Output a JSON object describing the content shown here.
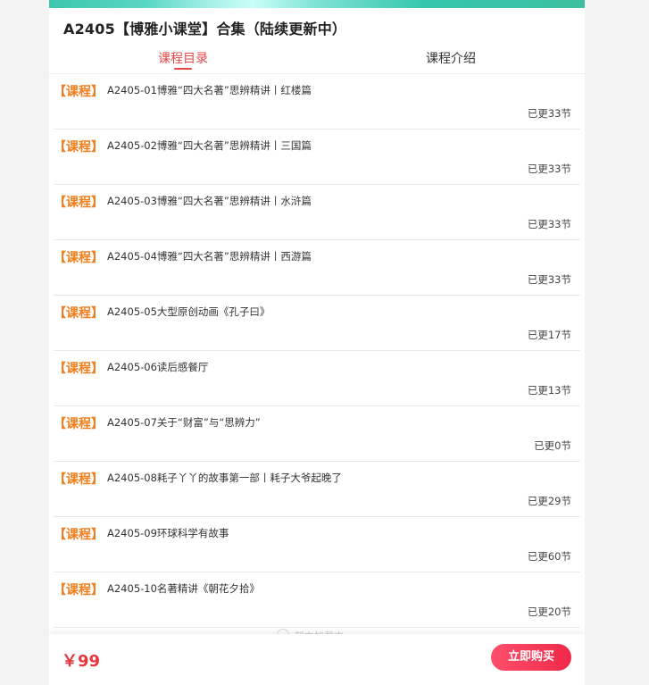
{
  "header": {
    "title": "A2405【博雅小课堂】合集（陆续更新中）"
  },
  "tabs": [
    {
      "label": "课程目录",
      "active": true
    },
    {
      "label": "课程介绍",
      "active": false
    }
  ],
  "course_list": {
    "items": [
      {
        "tag": "【课程】",
        "title": "A2405-01博雅“四大名著”思辨精讲丨红楼篇",
        "count": "已更33节"
      },
      {
        "tag": "【课程】",
        "title": "A2405-02博雅“四大名著”思辨精讲丨三国篇",
        "count": "已更33节"
      },
      {
        "tag": "【课程】",
        "title": "A2405-03博雅“四大名著”思辨精讲丨水浒篇",
        "count": "已更33节"
      },
      {
        "tag": "【课程】",
        "title": "A2405-04博雅“四大名著”思辨精讲丨西游篇",
        "count": "已更33节"
      },
      {
        "tag": "【课程】",
        "title": "A2405-05大型原创动画《孔子曰》",
        "count": "已更17节"
      },
      {
        "tag": "【课程】",
        "title": "A2405-06读后感餐厅",
        "count": "已更13节"
      },
      {
        "tag": "【课程】",
        "title": "A2405-07关于“财富”与“思辨力”",
        "count": "已更0节"
      },
      {
        "tag": "【课程】",
        "title": "A2405-08耗子丫丫的故事第一部丨耗子大爷起晚了",
        "count": "已更29节"
      },
      {
        "tag": "【课程】",
        "title": "A2405-09环球科学有故事",
        "count": "已更60节"
      },
      {
        "tag": "【课程】",
        "title": "A2405-10名著精讲《朝花夕拾》",
        "count": "已更20节"
      }
    ],
    "loading_text": "努力加载中"
  },
  "footer": {
    "price": "￥99",
    "buy_label": "立即购买"
  },
  "colors": {
    "accent_red": "#e84646",
    "tag_orange": "#f07f1e",
    "price_red": "#e8363d"
  }
}
